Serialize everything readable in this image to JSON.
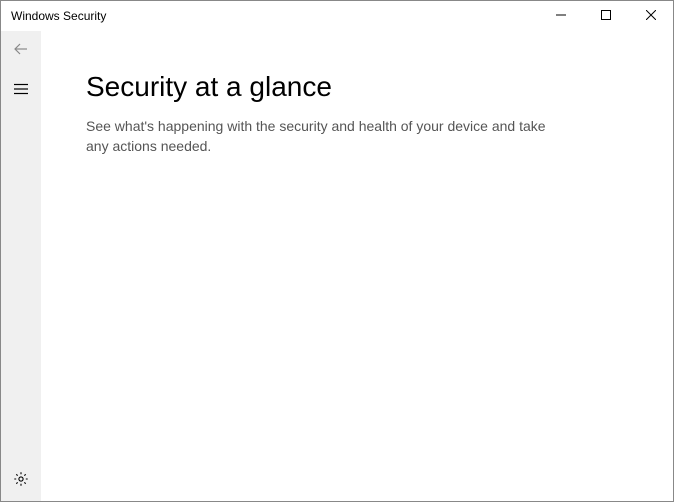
{
  "titlebar": {
    "title": "Windows Security"
  },
  "main": {
    "heading": "Security at a glance",
    "description": "See what's happening with the security and health of your device and take any actions needed."
  },
  "icons": {
    "back": "back-arrow-icon",
    "menu": "hamburger-icon",
    "settings": "gear-icon",
    "minimize": "minimize-icon",
    "maximize": "maximize-icon",
    "close": "close-icon"
  }
}
